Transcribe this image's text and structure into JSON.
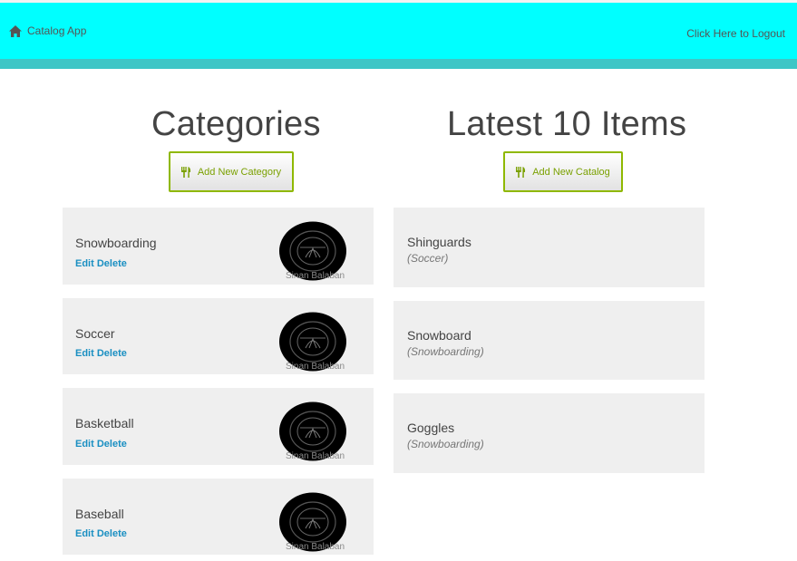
{
  "navbar": {
    "brand_label": "Catalog App",
    "brand_icon": "home-icon",
    "logout_label": "Click Here to Logout",
    "bg_color": "#00ffff",
    "stripe_color": "#3ec6c6"
  },
  "categories_section": {
    "title": "Categories",
    "add_button_label": "Add New Category",
    "add_button_icon": "cutlery-icon",
    "items": [
      {
        "name": "Snowboarding",
        "edit_label": "Edit",
        "delete_label": "Delete",
        "image_caption": "Sinan Balaban"
      },
      {
        "name": "Soccer",
        "edit_label": "Edit",
        "delete_label": "Delete",
        "image_caption": "Sinan Balaban"
      },
      {
        "name": "Basketball",
        "edit_label": "Edit",
        "delete_label": "Delete",
        "image_caption": "Sinan Balaban"
      },
      {
        "name": "Baseball",
        "edit_label": "Edit",
        "delete_label": "Delete",
        "image_caption": "Sinan Balaban"
      }
    ]
  },
  "items_section": {
    "title": "Latest 10 Items",
    "add_button_label": "Add New Catalog",
    "add_button_icon": "cutlery-icon",
    "items": [
      {
        "name": "Shinguards",
        "category": "(Soccer)"
      },
      {
        "name": "Snowboard",
        "category": "(Snowboarding)"
      },
      {
        "name": "Goggles",
        "category": "(Snowboarding)"
      }
    ]
  },
  "colors": {
    "accent_green": "#8fb800",
    "link_blue": "#1a8fc2",
    "card_bg": "#efefef"
  }
}
